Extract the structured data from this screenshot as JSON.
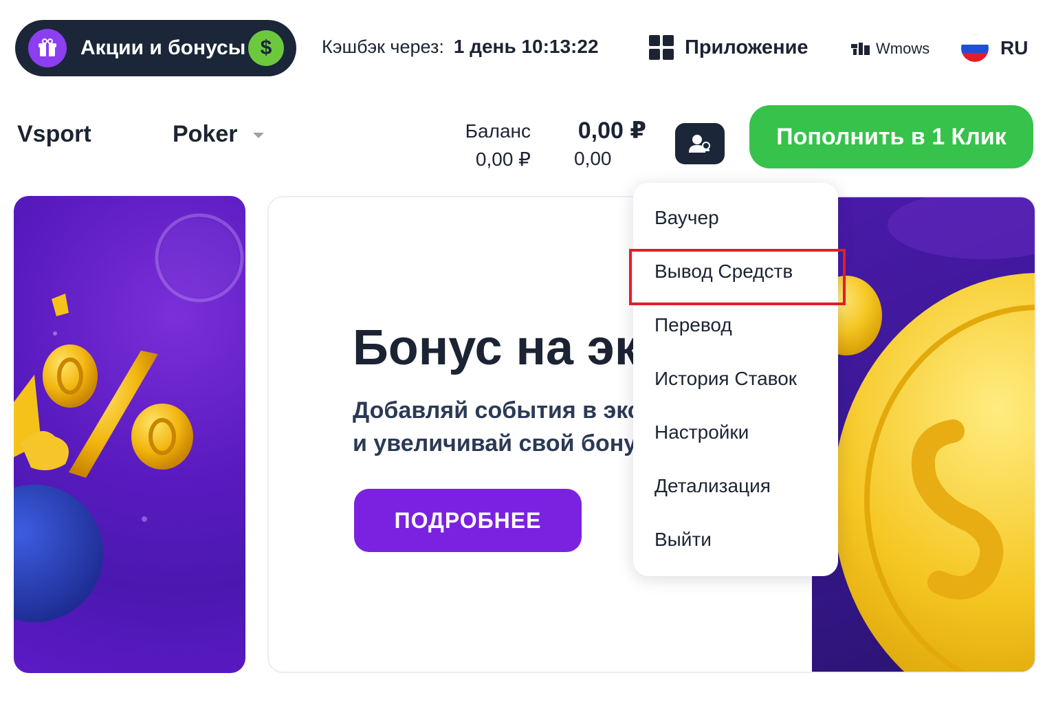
{
  "top": {
    "promo_label": "Акции и бонусы",
    "dollar_symbol": "$",
    "cashback_label": "Кэшбэк через:",
    "cashback_timer": "1 день 10:13:22",
    "app_label": "Приложение",
    "os_label": "Wmows",
    "language": "RU"
  },
  "nav": {
    "sport": "Vsport",
    "poker": "Poker"
  },
  "balance": {
    "label": "Баланс",
    "label_value": "0,00 ₽",
    "amount": "0,00 ₽",
    "bonus": "0,00"
  },
  "deposit_label": "Пополнить в 1 Клик",
  "banner": {
    "title": "Бонус на экс",
    "subtitle_line1": "Добавляй события в экс",
    "subtitle_line2": "и увеличивай свой бону",
    "button_label": "ПОДРОБНЕЕ"
  },
  "menu": {
    "items": [
      "Ваучер",
      "Вывод Средств",
      "Перевод",
      "История Ставок",
      "Настройки",
      "Детализация",
      "Выйти"
    ]
  },
  "colors": {
    "dark_navy": "#1b2639",
    "green": "#37c24b",
    "purple": "#7a22e0",
    "highlight_red": "#e31c2a"
  }
}
